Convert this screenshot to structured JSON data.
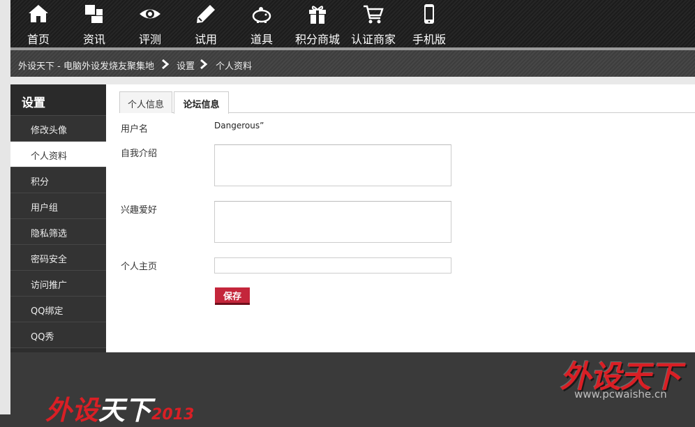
{
  "nav": {
    "items": [
      {
        "label": "首页",
        "icon": "home-icon"
      },
      {
        "label": "资讯",
        "icon": "news-icon"
      },
      {
        "label": "评测",
        "icon": "eye-icon"
      },
      {
        "label": "试用",
        "icon": "pencil-icon"
      },
      {
        "label": "道具",
        "icon": "piggy-bank-icon"
      },
      {
        "label": "积分商城",
        "icon": "gift-icon"
      },
      {
        "label": "认证商家",
        "icon": "cart-icon"
      },
      {
        "label": "手机版",
        "icon": "mobile-icon"
      }
    ]
  },
  "breadcrumb": {
    "items": [
      "外设天下 - 电脑外设发烧友聚集地",
      "设置",
      "个人资料"
    ]
  },
  "sidebar": {
    "title": "设置",
    "items": [
      {
        "label": "修改头像",
        "active": false
      },
      {
        "label": "个人资料",
        "active": true
      },
      {
        "label": "积分",
        "active": false
      },
      {
        "label": "用户组",
        "active": false
      },
      {
        "label": "隐私筛选",
        "active": false
      },
      {
        "label": "密码安全",
        "active": false
      },
      {
        "label": "访问推广",
        "active": false
      },
      {
        "label": "QQ绑定",
        "active": false
      },
      {
        "label": "QQ秀",
        "active": false
      }
    ]
  },
  "tabs": [
    {
      "label": "个人信息",
      "active": false
    },
    {
      "label": "论坛信息",
      "active": true
    }
  ],
  "form": {
    "username_label": "用户名",
    "username_value": "Dangerous”",
    "bio_label": "自我介绍",
    "bio_value": "",
    "hobbies_label": "兴趣爱好",
    "hobbies_value": "",
    "homepage_label": "个人主页",
    "homepage_value": "",
    "save_label": "保存"
  },
  "footer": {
    "watermark_text": "外设天下",
    "watermark_url": "www.pcwaishe.cn",
    "logo_red": "外设",
    "logo_white": "天下",
    "logo_year": "2013"
  },
  "colors": {
    "accent": "#c4263b",
    "nav_bg": "#222222",
    "sidebar_bg": "#333333",
    "active_bg": "#ffffff"
  }
}
